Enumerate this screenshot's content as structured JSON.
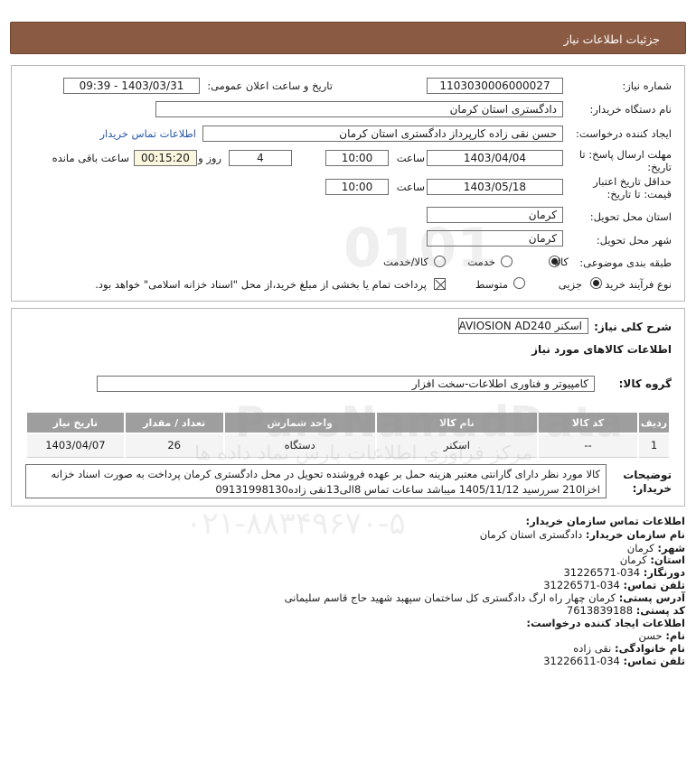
{
  "header": {
    "title": "جزئیات اطلاعات نیاز"
  },
  "form": {
    "need_number_label": "شماره نیاز:",
    "need_number": "1103030006000027",
    "announce_label": "تاریخ و ساعت اعلان عمومی:",
    "announce_value": "1403/03/31 - 09:39",
    "buyer_org_label": "نام دستگاه خریدار:",
    "buyer_org": "دادگستری استان کرمان",
    "creator_label": "ایجاد کننده درخواست:",
    "creator": "حسن نقی زاده کارپرداز دادگستری استان کرمان",
    "buyer_contact_link": "اطلاعات تماس خریدار",
    "deadline_label_1": "مهلت ارسال پاسخ: تا",
    "deadline_label_2": "تاریخ:",
    "deadline_date": "1403/04/04",
    "time_label": "ساعت",
    "deadline_time": "10:00",
    "days_value": "4",
    "days_label": "روز و",
    "remaining_value": "00:15:20",
    "remaining_label": "ساعت باقی مانده",
    "validity_label_1": "حداقل تاریخ اعتبار",
    "validity_label_2": "قیمت: تا تاریخ:",
    "validity_date": "1403/05/18",
    "validity_time": "10:00",
    "province_label": "استان محل تحویل:",
    "province": "کرمان",
    "city_label": "شهر محل تحویل:",
    "city": "کرمان",
    "category_label": "طبقه بندی موضوعی:",
    "category_options": [
      "کالا",
      "خدمت",
      "کالا/خدمت"
    ],
    "category_selected": "کالا",
    "process_label": "نوع فرآیند خرید :",
    "process_options": [
      "جزیی",
      "متوسط"
    ],
    "process_selected": "جزیی",
    "treasury_note": "پرداخت تمام یا بخشی از مبلغ خرید،از محل \"اسناد خزانه اسلامی\" خواهد بود."
  },
  "details": {
    "summary_label": "شرح کلی نیاز:",
    "summary_value": "اسکنر AVIOSION AD240",
    "goods_info_title": "اطلاعات کالاهای مورد نیاز",
    "goods_group_label": "گروه کالا:",
    "goods_group_value": "کامپیوتر و فناوری اطلاعات-سخت افزار",
    "table": {
      "headers": [
        "ردیف",
        "کد کالا",
        "نام کالا",
        "واحد شمارش",
        "تعداد / مقدار",
        "تاریخ نیاز"
      ],
      "rows": [
        [
          "1",
          "--",
          "اسکنر",
          "دستگاه",
          "26",
          "1403/04/07"
        ]
      ]
    },
    "buyer_notes_label_1": "توضیحات",
    "buyer_notes_label_2": "خریدار:",
    "buyer_notes": "کالا مورد نظر دارای گارانتی معتبر هزینه حمل بر عهده فروشنده تحویل در محل دادگستری کرمان پرداخت به صورت اسناد خزانه اخزا210 سررسید 1405/11/12 میباشد ساعات تماس 8الی13نقی زاده09131998130"
  },
  "contact": {
    "section_title": "اطلاعات تماس سازمان خریدار:",
    "buyer_name_label": "نام سازمان خریدار:",
    "buyer_name": "دادگستری استان کرمان",
    "city_label": "شهر:",
    "city": "کرمان",
    "province_label": "استان:",
    "province": "کرمان",
    "fax_label": "دورنگار:",
    "fax": "034-31226571",
    "phone_label": "تلفن تماس:",
    "phone": "034-31226571",
    "address_label": "آدرس پستی:",
    "address": "کرمان چهار راه ارگ دادگستری کل ساختمان سپهبد شهید حاج قاسم سلیمانی",
    "postal_label": "کد پستی:",
    "postal": "7613839188",
    "creator_title": "اطلاعات ایجاد کننده درخواست:",
    "first_name_label": "نام:",
    "first_name": "حسن",
    "last_name_label": "نام خانوادگی:",
    "last_name": "نقی زاده",
    "creator_phone_label": "تلفن تماس:",
    "creator_phone": "034-31226611"
  },
  "watermark": {
    "brand": "ParsNamadData",
    "phone": "۰۲۱-۸۸۳۴۹۶۷۰-۵",
    "tagline": "مرکز فرآوری اطلاعات پارس نماد داده ها",
    "digits": "0101"
  }
}
